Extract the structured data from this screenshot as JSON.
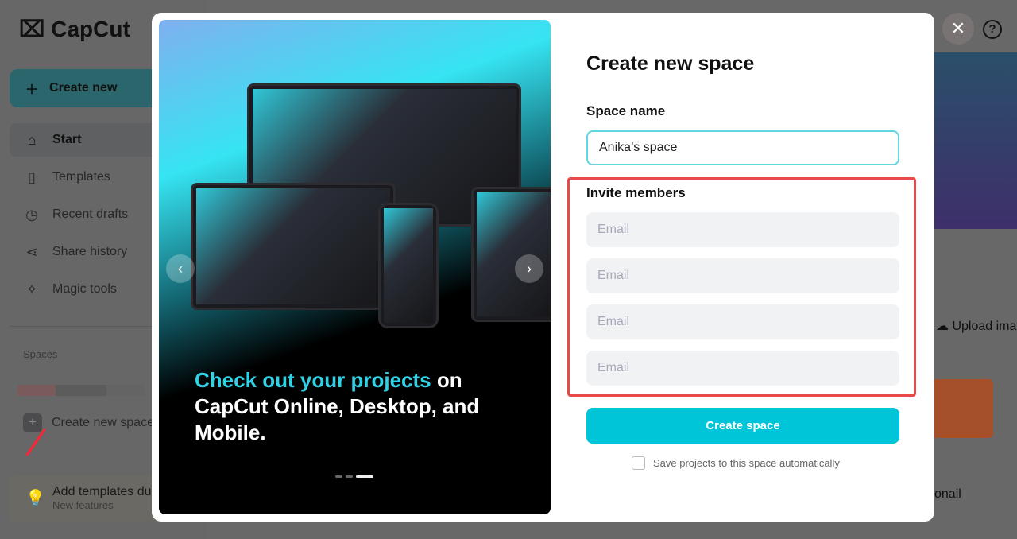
{
  "app": {
    "logo": "CapCut"
  },
  "sidebar": {
    "create_new": "Create new",
    "items": [
      {
        "label": "Start",
        "icon": "home-icon"
      },
      {
        "label": "Templates",
        "icon": "templates-icon"
      },
      {
        "label": "Recent drafts",
        "icon": "clock-icon"
      },
      {
        "label": "Share history",
        "icon": "share-icon"
      },
      {
        "label": "Magic tools",
        "icon": "magic-wand-icon"
      }
    ],
    "spaces_heading": "Spaces",
    "create_new_space": "Create new space",
    "promo_title": "Add templates du",
    "promo_sub": "New features"
  },
  "background": {
    "upload": "Upload ima",
    "thumbnail": "onail"
  },
  "modal": {
    "title": "Create new space",
    "space_name_label": "Space name",
    "space_name_value": "Anika’s space",
    "invite_label": "Invite members",
    "email_placeholder": "Email",
    "create_button": "Create space",
    "auto_save_label": "Save projects to this space automatically",
    "auto_save_checked": false,
    "hero": {
      "highlight": "Check out your projects",
      "rest": " on CapCut Online, Desktop, and Mobile.",
      "slide_index": 3,
      "slide_count": 3
    }
  },
  "colors": {
    "accent": "#00c4d8",
    "highlight_border": "#e84a4a"
  }
}
